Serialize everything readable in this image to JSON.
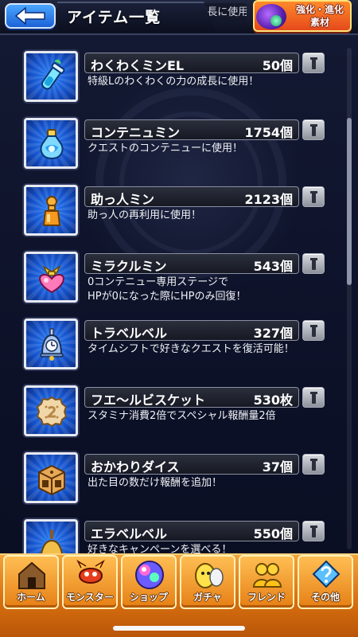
{
  "header": {
    "title": "アイテム一覧",
    "prev_desc": "特級Lのわくわくの力の成長に使用！",
    "upgrade_button": {
      "line1": "強化・進化",
      "line2": "素材"
    }
  },
  "items": [
    {
      "name": "わくわくミンEL",
      "count": "50個",
      "desc": "特級Lのわくわくの力の成長に使用！",
      "icon": "vial-icon"
    },
    {
      "name": "コンテニュミン",
      "count": "1754個",
      "desc": "クエストのコンテニューに使用！",
      "icon": "potion-bottle-icon"
    },
    {
      "name": "助っ人ミン",
      "count": "2123個",
      "desc": "助っ人の再利用に使用！",
      "icon": "bottle-icon"
    },
    {
      "name": "ミラクルミン",
      "count": "543個",
      "desc": "0コンテニュー専用ステージで\nHPが0になった際にHPのみ回復！",
      "icon": "heart-potion-icon"
    },
    {
      "name": "トラベルベル",
      "count": "327個",
      "desc": "タイムシフトで好きなクエストを復活可能！",
      "icon": "bell-clock-icon"
    },
    {
      "name": "フエ〜ルビスケット",
      "count": "530枚",
      "desc": "スタミナ消費2倍でスペシャル報酬量2倍",
      "icon": "biscuit-icon"
    },
    {
      "name": "おかわりダイス",
      "count": "37個",
      "desc": "出た目の数だけ報酬を追加！",
      "icon": "dice-icon"
    },
    {
      "name": "エラベルベル",
      "count": "550個",
      "desc": "好きなキャンペーンを選べる！",
      "icon": "handbell-icon"
    }
  ],
  "nav": [
    {
      "label": "ホーム",
      "icon": "house-icon"
    },
    {
      "label": "モンスター",
      "icon": "monster-icon"
    },
    {
      "label": "ショップ",
      "icon": "orb-icon"
    },
    {
      "label": "ガチャ",
      "icon": "gacha-egg-icon"
    },
    {
      "label": "フレンド",
      "icon": "friends-icon"
    },
    {
      "label": "その他",
      "icon": "other-icon"
    }
  ],
  "colors": {
    "accent": "#1c62d6",
    "nav": "#e57f15",
    "upgrade": "#e5491b"
  }
}
